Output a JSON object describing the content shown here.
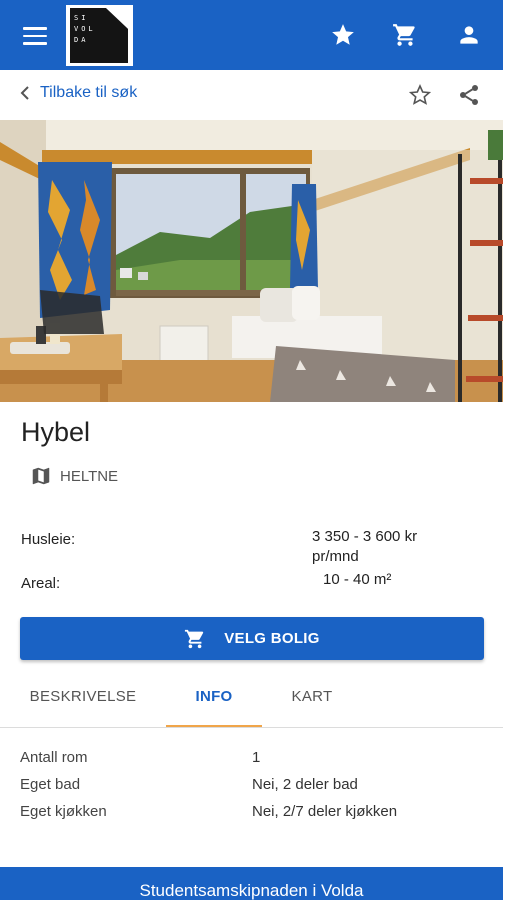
{
  "topbar": {
    "logo_text": "SI\nVOL\nDA",
    "icons": [
      "menu-icon",
      "star-icon",
      "cart-icon",
      "account-icon"
    ]
  },
  "backbar": {
    "back_label": "Tilbake til søk",
    "icons": [
      "chevron-left-icon",
      "star-outline-icon",
      "share-icon"
    ]
  },
  "listing": {
    "title": "Hybel",
    "location": "HELTNE",
    "rent_label": "Husleie:",
    "rent_value_line1": "3 350 - 3 600 kr",
    "rent_value_line2": "pr/mnd",
    "area_label": "Areal:",
    "area_value": "10 - 40 m²"
  },
  "action": {
    "select_label": "VELG BOLIG"
  },
  "tabs": [
    {
      "label": "BESKRIVELSE",
      "active": false
    },
    {
      "label": "INFO",
      "active": true
    },
    {
      "label": "KART",
      "active": false
    }
  ],
  "info": [
    {
      "label": "Antall rom",
      "value": "1"
    },
    {
      "label": "Eget bad",
      "value": "Nei, 2 deler bad"
    },
    {
      "label": "Eget kjøkken",
      "value": "Nei, 2/7 deler kjøkken"
    }
  ],
  "footer": {
    "text": "Studentsamskipnaden i Volda"
  },
  "colors": {
    "primary": "#1a62c4",
    "tab_indicator": "#f0a54a"
  }
}
